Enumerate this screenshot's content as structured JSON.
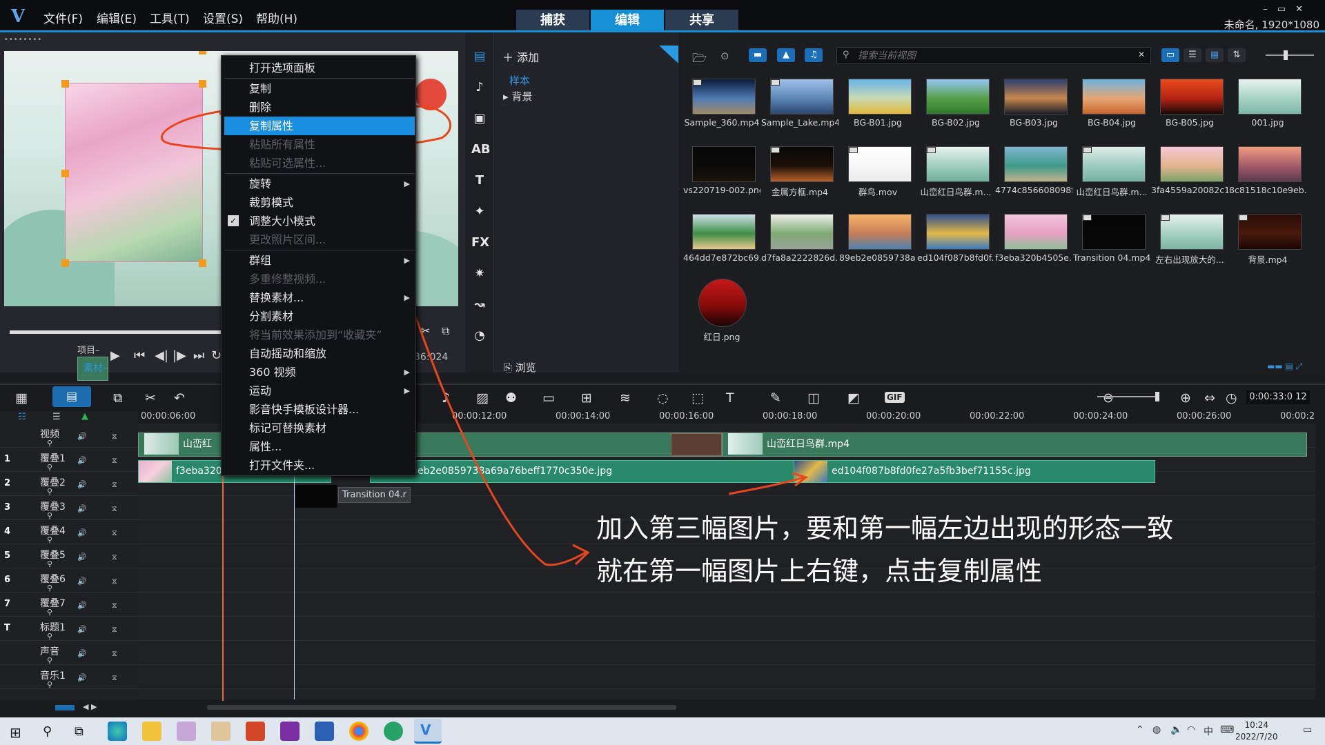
{
  "app": {
    "title_menu": [
      "文件(F)",
      "编辑(E)",
      "工具(T)",
      "设置(S)",
      "帮助(H)"
    ],
    "modes": [
      "捕获",
      "编辑",
      "共享"
    ],
    "active_mode": "编辑",
    "project_info": "未命名, 1920*1080"
  },
  "preview": {
    "project_label": "项目–",
    "clip_label": "素材–",
    "timecode_fragment": "36:024"
  },
  "library": {
    "add_label": "添加",
    "tree": [
      "样本",
      "背景"
    ],
    "browse_label": "浏览",
    "search_placeholder": "搜索当前视图",
    "items": [
      {
        "name": "Sample_360.mp4",
        "type": "video",
        "colors": [
          "#0b1a3a",
          "#4e7bb3",
          "#a08a67"
        ]
      },
      {
        "name": "Sample_Lake.mp4",
        "type": "video",
        "colors": [
          "#9fc0e8",
          "#5d87b8",
          "#2b466d"
        ]
      },
      {
        "name": "BG-B01.jpg",
        "type": "image",
        "colors": [
          "#69b4ea",
          "#c8d9b1",
          "#e1b83b"
        ]
      },
      {
        "name": "BG-B02.jpg",
        "type": "image",
        "colors": [
          "#93c6f2",
          "#57a04a",
          "#2f7a2b"
        ]
      },
      {
        "name": "BG-B03.jpg",
        "type": "image",
        "colors": [
          "#2b3d6e",
          "#c7874c",
          "#1c1d2c"
        ]
      },
      {
        "name": "BG-B04.jpg",
        "type": "image",
        "colors": [
          "#6cb2e0",
          "#e6a775",
          "#c9652e"
        ]
      },
      {
        "name": "BG-B05.jpg",
        "type": "image",
        "colors": [
          "#ea4b1c",
          "#b52414",
          "#1b0a06"
        ]
      },
      {
        "name": "001.jpg",
        "type": "image",
        "colors": [
          "#e9f2ef",
          "#a7d3c4",
          "#7bb7a6"
        ]
      },
      {
        "name": "vs220719-002.png",
        "type": "image",
        "colors": [
          "#070707",
          "#0b0b0b",
          "#1a1208"
        ]
      },
      {
        "name": "金属方框.mp4",
        "type": "video",
        "colors": [
          "#080808",
          "#1c0f07",
          "#b6622b"
        ]
      },
      {
        "name": "群鸟.mov",
        "type": "video",
        "colors": [
          "#ffffff",
          "#f6f6f6",
          "#ececec"
        ]
      },
      {
        "name": "山峦红日鸟群.m...",
        "type": "video",
        "colors": [
          "#e7f1ee",
          "#9fcfc0",
          "#6fae99"
        ]
      },
      {
        "name": "4774c856608098f...",
        "type": "image",
        "colors": [
          "#7fb7d1",
          "#3f9a8a",
          "#c2b48d"
        ]
      },
      {
        "name": "山峦红日鸟群.m...",
        "type": "video",
        "colors": [
          "#dfece8",
          "#9ccbbd",
          "#76b2a0"
        ]
      },
      {
        "name": "3fa4559a20082c1...",
        "type": "image",
        "colors": [
          "#f6c8d5",
          "#e3b48d",
          "#7ca36a"
        ]
      },
      {
        "name": "8c81518c10e9eb...",
        "type": "image",
        "colors": [
          "#f19b7f",
          "#a55b6a",
          "#5a3a4e"
        ]
      },
      {
        "name": "464dd7e872bc69...",
        "type": "image",
        "colors": [
          "#cfe1e9",
          "#3e8d48",
          "#e6c98b"
        ]
      },
      {
        "name": "d7fa8a2222826d...",
        "type": "image",
        "colors": [
          "#eef0e9",
          "#7faa74",
          "#9aa39b"
        ]
      },
      {
        "name": "89eb2e0859738a...",
        "type": "image",
        "colors": [
          "#f5b36a",
          "#c87d58",
          "#4f82b0"
        ]
      },
      {
        "name": "ed104f087b8fd0f...",
        "type": "image",
        "colors": [
          "#2f4f8a",
          "#e3b84a",
          "#3b7ac0"
        ]
      },
      {
        "name": "f3eba320b4505e...",
        "type": "image",
        "colors": [
          "#f1c6dc",
          "#e7a0c4",
          "#8fbf99"
        ]
      },
      {
        "name": "Transition 04.mp4",
        "type": "video",
        "colors": [
          "#060606",
          "#070707",
          "#080808"
        ]
      },
      {
        "name": "左右出现放大的...",
        "type": "video",
        "colors": [
          "#e6f0ed",
          "#a6d1c3",
          "#7cb5a3"
        ]
      },
      {
        "name": "背景.mp4",
        "type": "video",
        "colors": [
          "#2a0c07",
          "#4a1a0c",
          "#1a0704"
        ]
      },
      {
        "name": "红日.png",
        "type": "image",
        "colors": [
          "#c31818",
          "#8a0c0c",
          "#1a0303"
        ]
      }
    ]
  },
  "timeline": {
    "timecode": "0:00:33:0 12",
    "ruler": [
      "00:00:06:00",
      "00:00:12:00",
      "00:00:14:00",
      "00:00:16:00",
      "00:00:18:00",
      "00:00:20:00",
      "00:00:22:00",
      "00:00:24:00",
      "00:00:26:00",
      "00:00:2"
    ],
    "tracks": [
      {
        "num": "",
        "name": "视频"
      },
      {
        "num": "1",
        "name": "覆叠1"
      },
      {
        "num": "2",
        "name": "覆叠2"
      },
      {
        "num": "3",
        "name": "覆叠3"
      },
      {
        "num": "4",
        "name": "覆叠4"
      },
      {
        "num": "5",
        "name": "覆叠5"
      },
      {
        "num": "6",
        "name": "覆叠6"
      },
      {
        "num": "7",
        "name": "覆叠7"
      },
      {
        "num": "T",
        "name": "标题1"
      },
      {
        "num": "",
        "name": "声音"
      },
      {
        "num": "",
        "name": "音乐1"
      }
    ],
    "clips": {
      "video_left": "山峦红",
      "video_right": "山峦红日鸟群.mp4",
      "overlay_left": "f3eba320b4",
      "overlay_mid": "eb2e0859738a69a76beff1770c350e.jpg",
      "overlay_right": "ed104f087b8fd0fe27a5fb3bef71155c.jpg",
      "transition_tip": "Transition 04.r"
    }
  },
  "context_menu": {
    "items": [
      {
        "label": "打开选项面板",
        "disabled": false
      },
      {
        "label": "复制",
        "disabled": false
      },
      {
        "label": "删除",
        "disabled": false
      },
      {
        "label": "复制属性",
        "disabled": false,
        "selected": true
      },
      {
        "label": "粘贴所有属性",
        "disabled": true
      },
      {
        "label": "粘贴可选属性...",
        "disabled": true
      },
      {
        "label": "旋转",
        "disabled": false,
        "submenu": true
      },
      {
        "label": "裁剪模式",
        "disabled": false
      },
      {
        "label": "调整大小模式",
        "disabled": false,
        "checked": true
      },
      {
        "label": "更改照片区间...",
        "disabled": true
      },
      {
        "label": "群组",
        "disabled": false,
        "submenu": true
      },
      {
        "label": "多重修整视频...",
        "disabled": true
      },
      {
        "label": "替换素材...",
        "disabled": false,
        "submenu": true
      },
      {
        "label": "分割素材",
        "disabled": false
      },
      {
        "label": "将当前效果添加到“收藏夹”",
        "disabled": true
      },
      {
        "label": "自动摇动和缩放",
        "disabled": false
      },
      {
        "label": "360 视频",
        "disabled": false,
        "submenu": true
      },
      {
        "label": "运动",
        "disabled": false,
        "submenu": true
      },
      {
        "label": "影音快手模板设计器...",
        "disabled": false
      },
      {
        "label": "标记可替换素材",
        "disabled": false
      },
      {
        "label": "属性...",
        "disabled": false
      },
      {
        "label": "打开文件夹...",
        "disabled": false
      }
    ]
  },
  "annotation": {
    "line1": "加入第三幅图片，要和第一幅左边出现的形态一致",
    "line2": "就在第一幅图片上右键，点击复制属性",
    "color": "#e8461e"
  },
  "taskbar": {
    "time": "10:24",
    "date": "2022/7/20"
  }
}
